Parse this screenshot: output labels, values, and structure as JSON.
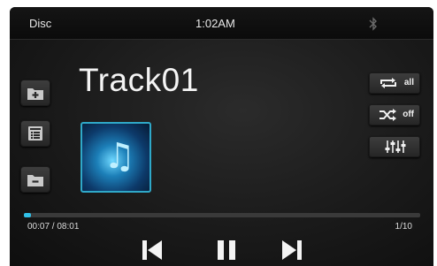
{
  "status_bar": {
    "source": "Disc",
    "clock": "1:02AM",
    "bluetooth_icon": "bluetooth-icon"
  },
  "track": {
    "title": "Track01"
  },
  "progress": {
    "elapsed_total": "00:07 / 08:01",
    "fraction": 0.015,
    "track_position": "1/10"
  },
  "left_buttons": [
    "folder-add-icon",
    "list-icon",
    "folder-remove-icon"
  ],
  "right_buttons": {
    "repeat_label": "all",
    "shuffle_label": "off",
    "eq_icon": "equalizer-icon"
  },
  "controls": [
    "previous-icon",
    "pause-icon",
    "next-icon"
  ],
  "colors": {
    "accent": "#30c0e8",
    "background": "#1a1a1a"
  }
}
